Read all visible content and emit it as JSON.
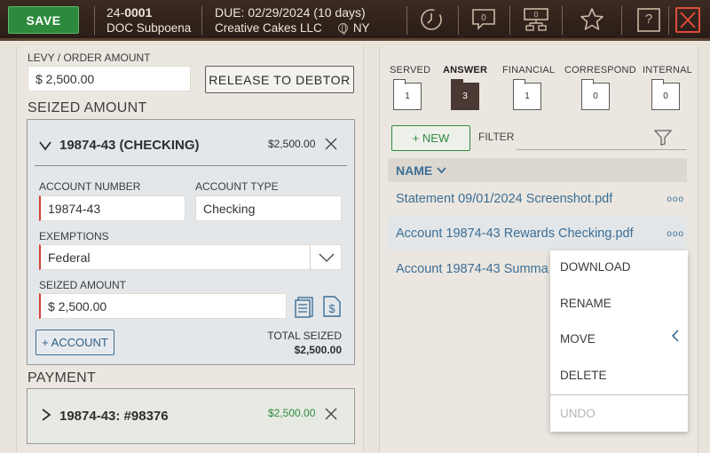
{
  "header": {
    "save_label": "SAVE",
    "case_prefix": "24-",
    "case_number": "0001",
    "doc_type": "DOC Subpoena",
    "due_label": "DUE: 02/29/2024 (10 days)",
    "company": "Creative Cakes LLC",
    "state": "NY",
    "icons": [
      "clock-icon",
      "comment-icon",
      "org-chart-icon",
      "star-icon",
      "help-icon",
      "close-icon"
    ],
    "help_text": "?"
  },
  "left": {
    "levy_label": "LEVY / ORDER AMOUNT",
    "levy_value": "$ 2,500.00",
    "release_label": "RELEASE TO DEBTOR",
    "seized_section_title": "SEIZED AMOUNT",
    "account_card": {
      "title": "19874-43 (CHECKING)",
      "amount": "$2,500.00",
      "account_number_label": "ACCOUNT NUMBER",
      "account_number_value": "19874-43",
      "account_type_label": "ACCOUNT TYPE",
      "account_type_value": "Checking",
      "exemptions_label": "EXEMPTIONS",
      "exemptions_value": "Federal",
      "seized_amount_label": "SEIZED AMOUNT",
      "seized_amount_value": "$ 2,500.00",
      "add_account_label": "+ ACCOUNT",
      "total_seized_label": "TOTAL SEIZED",
      "total_seized_value": "$2,500.00"
    },
    "payment_section_title": "PAYMENT",
    "payment_card": {
      "title": "19874-43: #98376",
      "amount": "$2,500.00",
      "amount_color": "#2f8a3e"
    }
  },
  "right": {
    "tabs": [
      {
        "label": "SERVED",
        "count": "1",
        "active": false
      },
      {
        "label": "ANSWER",
        "count": "3",
        "active": true
      },
      {
        "label": "FINANCIAL",
        "count": "1",
        "active": false
      },
      {
        "label": "CORRESPOND",
        "count": "0",
        "active": false
      },
      {
        "label": "INTERNAL",
        "count": "0",
        "active": false
      }
    ],
    "new_label": "+ NEW",
    "filter_label": "FILTER",
    "name_header": "NAME",
    "files": [
      {
        "name": "Statement 09/01/2024 Screenshot.pdf",
        "more": "ooo"
      },
      {
        "name": "Account 19874-43 Rewards Checking.pdf",
        "more": "ooo"
      },
      {
        "name": "Account 19874-43 Summa"
      }
    ],
    "context_menu": {
      "download": "DOWNLOAD",
      "rename": "RENAME",
      "move": "MOVE",
      "delete": "DELETE",
      "undo": "UNDO"
    }
  },
  "colors": {
    "header_bg": "#2f211a",
    "save_green": "#2d8a3c",
    "link_blue": "#3c6e96",
    "required_red": "#d6423a",
    "close_red": "#e04c3c"
  }
}
